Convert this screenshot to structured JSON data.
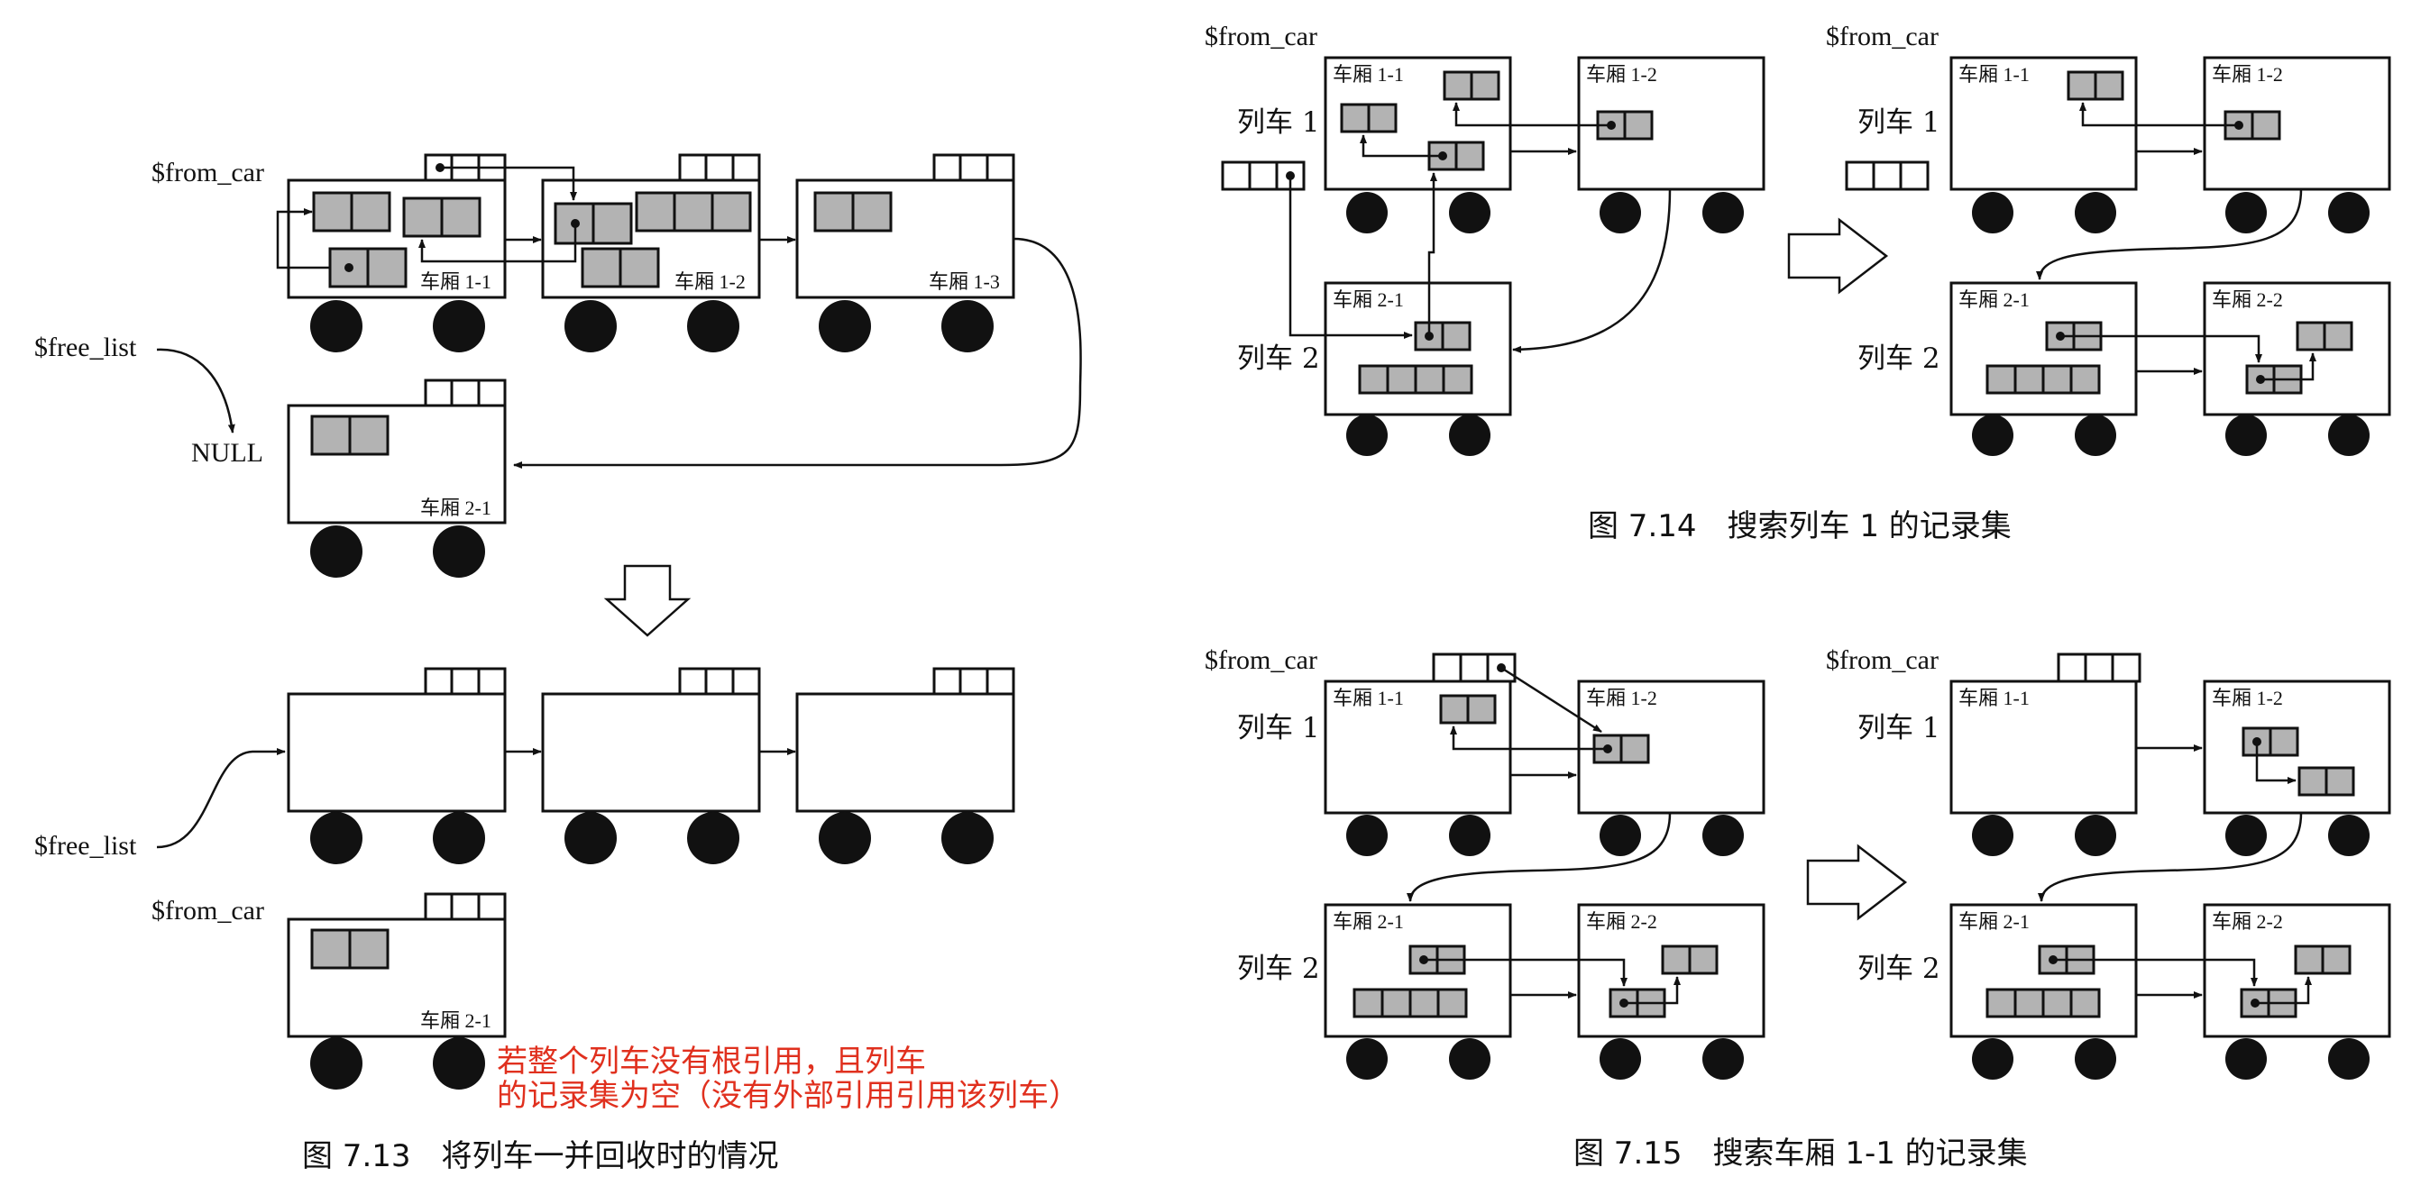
{
  "fig13": {
    "from_car": "$from_car",
    "free_list": "$free_list",
    "null_label": "NULL",
    "car_1_1": "车厢 1-1",
    "car_1_2": "车厢 1-2",
    "car_1_3": "车厢 1-3",
    "car_2_1": "车厢 2-1",
    "note_line1": "若整个列车没有根引用，且列车",
    "note_line2": "的记录集为空（没有外部引用引用该列车）",
    "caption": "图 7.13　将列车一并回收时的情况"
  },
  "fig14": {
    "from_car": "$from_car",
    "train_1": "列车 1",
    "train_2": "列车 2",
    "car_1_1": "车厢 1-1",
    "car_1_2": "车厢 1-2",
    "car_2_1": "车厢 2-1",
    "car_2_2": "车厢 2-2",
    "caption": "图 7.14　搜索列车 1 的记录集"
  },
  "fig15": {
    "from_car": "$from_car",
    "train_1": "列车 1",
    "train_2": "列车 2",
    "car_1_1": "车厢 1-1",
    "car_1_2": "车厢 1-2",
    "car_2_1": "车厢 2-1",
    "car_2_2": "车厢 2-2",
    "caption": "图 7.15　搜索车厢 1-1 的记录集"
  },
  "colors": {
    "object_fill": "#b3b3b3",
    "stroke": "#111111",
    "note": "#e0301e"
  }
}
